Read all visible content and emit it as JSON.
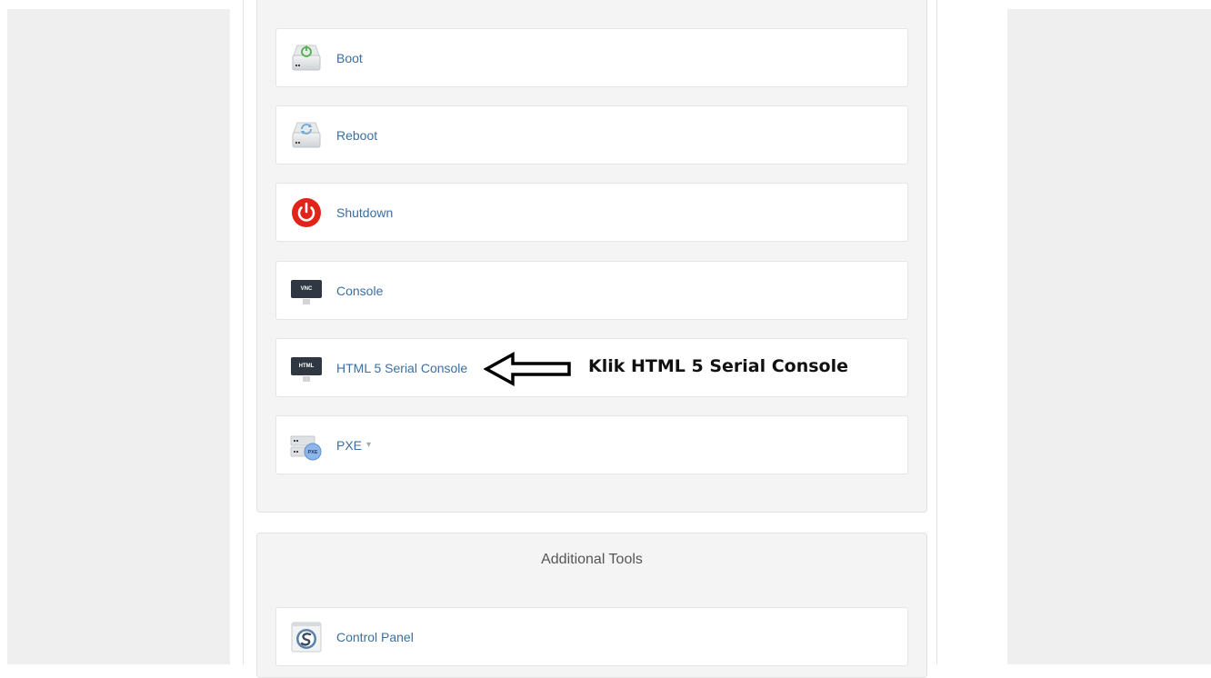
{
  "actions": [
    {
      "label": "Boot",
      "icon": "power-on-drive-icon"
    },
    {
      "label": "Reboot",
      "icon": "reboot-drive-icon"
    },
    {
      "label": "Shutdown",
      "icon": "red-power-icon"
    },
    {
      "label": "Console",
      "icon": "vnc-monitor-icon",
      "badge": "VNC"
    },
    {
      "label": "HTML 5 Serial Console",
      "icon": "html-monitor-icon",
      "badge": "HTML"
    },
    {
      "label": "PXE",
      "icon": "pxe-drive-icon",
      "badge": "PXE"
    }
  ],
  "annotation": {
    "text": "Klik HTML 5 Serial Console"
  },
  "additional_tools": {
    "title": "Additional Tools",
    "items": [
      {
        "label": "Control Panel",
        "icon": "control-panel-icon"
      }
    ]
  },
  "colors": {
    "link": "#3c6fa0",
    "shutdown_red": "#e2231a",
    "page_bg": "#efefef",
    "panel_bg": "#f4f4f4"
  }
}
